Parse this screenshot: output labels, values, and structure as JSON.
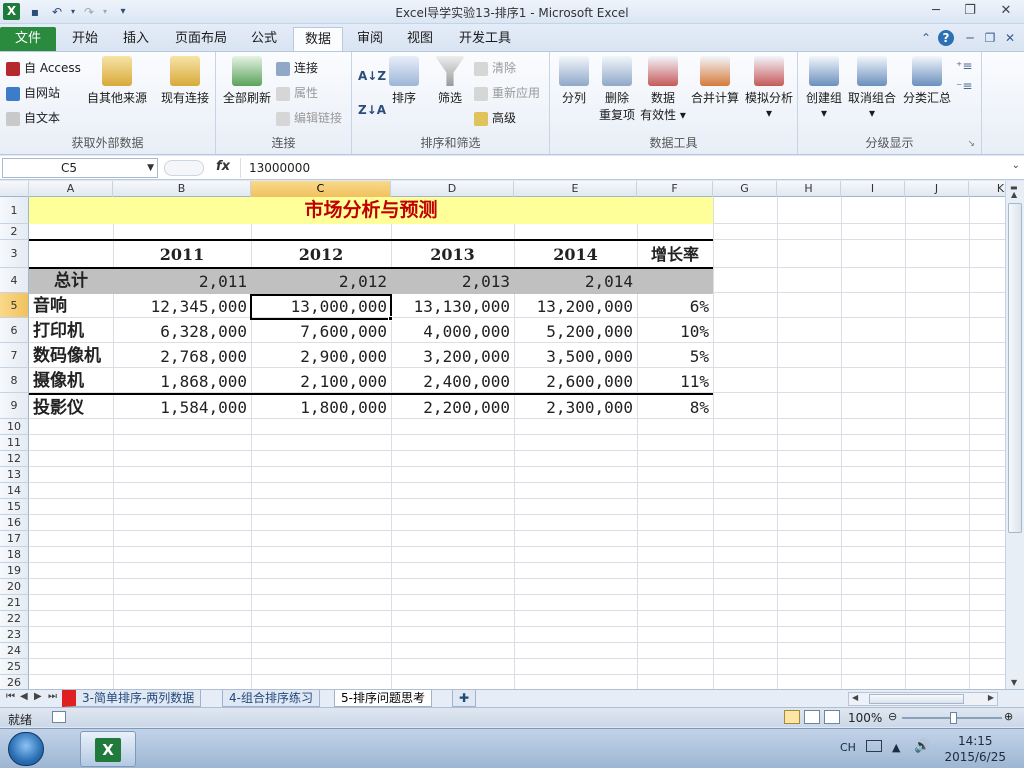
{
  "window": {
    "title": "Excel导学实验13-排序1  -  Microsoft Excel",
    "app_icon": "X"
  },
  "ribbon_tabs": [
    "文件",
    "开始",
    "插入",
    "页面布局",
    "公式",
    "数据",
    "审阅",
    "视图",
    "开发工具"
  ],
  "ribbon": {
    "external": {
      "access": "自 Access",
      "web": "自网站",
      "text": "自文本",
      "other": "自其他来源",
      "existing": "现有连接",
      "label": "获取外部数据"
    },
    "connections": {
      "refresh": "全部刷新",
      "connect": "连接",
      "properties": "属性",
      "edit_links": "编辑链接",
      "label": "连接"
    },
    "sort_filter": {
      "sort": "排序",
      "filter": "筛选",
      "clear": "清除",
      "reapply": "重新应用",
      "advanced": "高级",
      "label": "排序和筛选"
    },
    "data_tools": {
      "split": "分列",
      "remove_dup_1": "删除",
      "remove_dup_2": "重复项",
      "validation_1": "数据",
      "validation_2": "有效性",
      "consolidate": "合并计算",
      "whatif": "模拟分析",
      "label": "数据工具"
    },
    "outline": {
      "group": "创建组",
      "ungroup": "取消组合",
      "subtotal": "分类汇总",
      "label": "分级显示"
    }
  },
  "formula_bar": {
    "name_box": "C5",
    "fx": "fx",
    "content": "13000000"
  },
  "columns": [
    "A",
    "B",
    "C",
    "D",
    "E",
    "F",
    "G",
    "H",
    "I",
    "J",
    "K"
  ],
  "rows": [
    "1",
    "2",
    "3",
    "4",
    "5",
    "6",
    "7",
    "8",
    "9",
    "10",
    "11",
    "12",
    "13",
    "14",
    "15",
    "16",
    "17",
    "18",
    "19",
    "20",
    "21",
    "22",
    "23",
    "24",
    "25",
    "26"
  ],
  "sheet": {
    "title": "市场分析与预测",
    "years": [
      "2011",
      "2012",
      "2013",
      "2014"
    ],
    "growth_header": "增长率",
    "total_row": {
      "label": "总计",
      "values": [
        "2,011",
        "2,012",
        "2,013",
        "2,014"
      ]
    },
    "data_rows": [
      {
        "label": "音响",
        "values": [
          "12,345,000",
          "13,000,000",
          "13,130,000",
          "13,200,000"
        ],
        "growth": "6%"
      },
      {
        "label": "打印机",
        "values": [
          "6,328,000",
          "7,600,000",
          "4,000,000",
          "5,200,000"
        ],
        "growth": "10%"
      },
      {
        "label": "数码像机",
        "values": [
          "2,768,000",
          "2,900,000",
          "3,200,000",
          "3,500,000"
        ],
        "growth": "5%"
      },
      {
        "label": "摄像机",
        "values": [
          "1,868,000",
          "2,100,000",
          "2,400,000",
          "2,600,000"
        ],
        "growth": "11%"
      },
      {
        "label": "投影仪",
        "values": [
          "1,584,000",
          "1,800,000",
          "2,200,000",
          "2,300,000"
        ],
        "growth": "8%"
      }
    ]
  },
  "sheet_tabs": [
    "3-简单排序-两列数据",
    "4-组合排序练习",
    "5-排序问题思考"
  ],
  "status": {
    "ready": "就绪",
    "zoom": "100%"
  },
  "taskbar": {
    "lang": "CH",
    "time": "14:15",
    "date": "2015/6/25"
  },
  "colors": {
    "title_fill": "#ffff99",
    "title_text": "#c00000",
    "total_fill": "#c0c0c0",
    "accent_green": "#2a8a3e"
  }
}
